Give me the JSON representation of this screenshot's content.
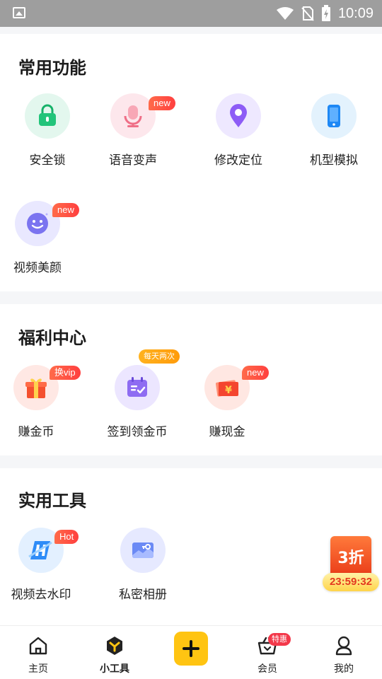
{
  "status_bar": {
    "time": "10:09"
  },
  "sections": {
    "common": {
      "title": "常用功能",
      "items": [
        {
          "label": "安全锁",
          "icon": "lock-icon"
        },
        {
          "label": "语音变声",
          "icon": "microphone-icon",
          "badge": "new"
        },
        {
          "label": "修改定位",
          "icon": "location-pin-icon"
        },
        {
          "label": "机型模拟",
          "icon": "phone-icon"
        },
        {
          "label": "视频美颜",
          "icon": "smiley-face-icon",
          "badge": "new"
        }
      ]
    },
    "welfare": {
      "title": "福利中心",
      "items": [
        {
          "label": "赚金币",
          "icon": "gift-box-icon",
          "badge": "换vip"
        },
        {
          "label": "签到领金币",
          "icon": "calendar-check-icon",
          "badge": "每天两次"
        },
        {
          "label": "赚现金",
          "icon": "cash-envelope-icon",
          "badge": "new"
        }
      ]
    },
    "tools": {
      "title": "实用工具",
      "items": [
        {
          "label": "视频去水印",
          "icon": "watermark-remove-icon",
          "badge": "Hot"
        },
        {
          "label": "私密相册",
          "icon": "private-album-icon"
        }
      ]
    }
  },
  "promo": {
    "discount": "3折",
    "countdown": "23:59:32"
  },
  "tab_bar": {
    "items": [
      {
        "label": "主页",
        "icon": "home-icon"
      },
      {
        "label": "小工具",
        "icon": "tools-icon",
        "active": true
      },
      {
        "label": "",
        "icon": "plus-icon"
      },
      {
        "label": "会员",
        "icon": "vip-basket-icon",
        "badge": "特惠"
      },
      {
        "label": "我的",
        "icon": "profile-icon"
      }
    ]
  },
  "colors": {
    "accent_yellow": "#ffc412",
    "badge_red": "#ff4b3f",
    "status_bar": "#9e9e9e"
  }
}
